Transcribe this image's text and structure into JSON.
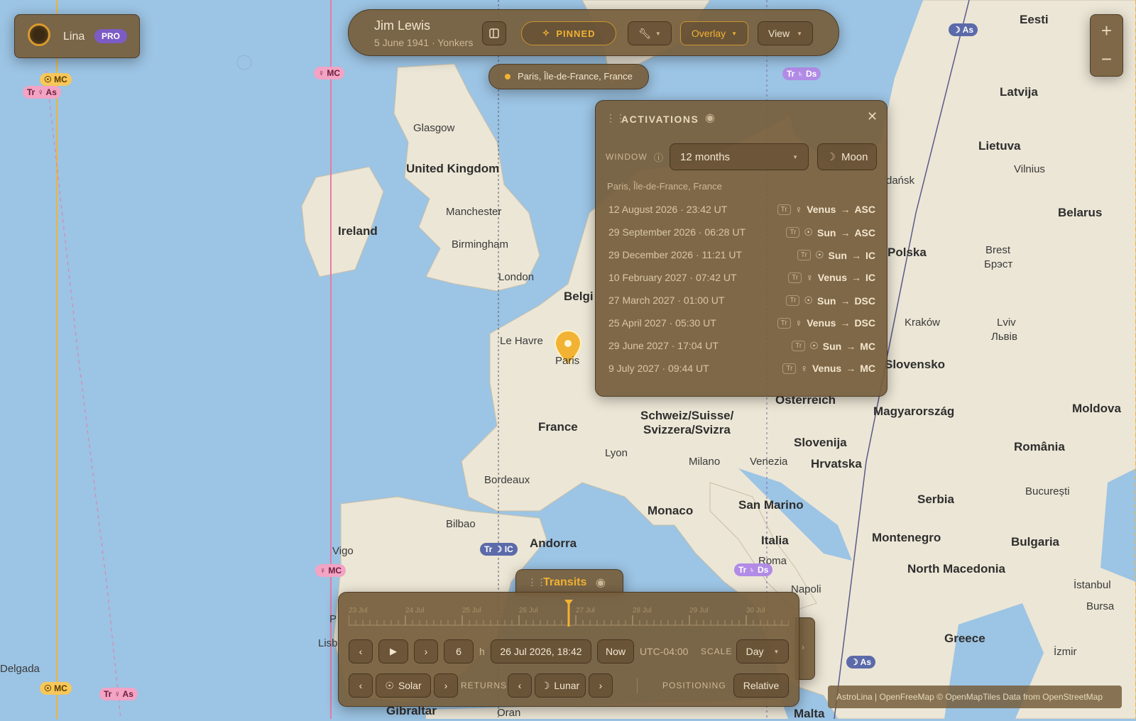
{
  "profile": {
    "name": "Lina",
    "badge": "PRO"
  },
  "chart": {
    "name": "Jim Lewis",
    "subtitle": "5 June 1941 · Yonkers"
  },
  "toolbar": {
    "pinned_label": "PINNED",
    "overlay_label": "Overlay",
    "view_label": "View"
  },
  "location_chip": {
    "label": "Paris, Île-de-France, France"
  },
  "zoom": {
    "plus": "+",
    "minus": "−"
  },
  "activations": {
    "title": "ACTIVATIONS",
    "window_label": "WINDOW",
    "window_value": "12 months",
    "moon_label": "Moon",
    "place": "Paris, Île-de-France, France",
    "rows": [
      {
        "date": "12 August 2026 · 23:42 UT",
        "tag": "Tr",
        "glyph": "♀",
        "planet": "Venus",
        "arrow": "→",
        "angle": "ASC"
      },
      {
        "date": "29 September 2026 · 06:28 UT",
        "tag": "Tr",
        "glyph": "☉",
        "planet": "Sun",
        "arrow": "→",
        "angle": "ASC"
      },
      {
        "date": "29 December 2026 · 11:21 UT",
        "tag": "Tr",
        "glyph": "☉",
        "planet": "Sun",
        "arrow": "→",
        "angle": "IC"
      },
      {
        "date": "10 February 2027 · 07:42 UT",
        "tag": "Tr",
        "glyph": "♀",
        "planet": "Venus",
        "arrow": "→",
        "angle": "IC"
      },
      {
        "date": "27 March 2027 · 01:00 UT",
        "tag": "Tr",
        "glyph": "☉",
        "planet": "Sun",
        "arrow": "→",
        "angle": "DSC"
      },
      {
        "date": "25 April 2027 · 05:30 UT",
        "tag": "Tr",
        "glyph": "♀",
        "planet": "Venus",
        "arrow": "→",
        "angle": "DSC"
      },
      {
        "date": "29 June 2027 · 17:04 UT",
        "tag": "Tr",
        "glyph": "☉",
        "planet": "Sun",
        "arrow": "→",
        "angle": "MC"
      },
      {
        "date": "9 July 2027 · 09:44 UT",
        "tag": "Tr",
        "glyph": "♀",
        "planet": "Venus",
        "arrow": "→",
        "angle": "MC"
      }
    ]
  },
  "transits": {
    "tab_label": "Transits",
    "ticks": [
      "23 Jul",
      "24 Jul",
      "25 Jul",
      "26 Jul",
      "27 Jul",
      "28 Jul",
      "29 Jul",
      "30 Jul"
    ],
    "step_value": "6",
    "step_unit": "h",
    "datetime": "26 Jul 2026, 18:42",
    "now_label": "Now",
    "timezone": "UTC-04:00",
    "scale_label": "SCALE",
    "scale_value": "Day",
    "solar_label": "Solar",
    "returns_label": "RETURNS",
    "lunar_label": "Lunar",
    "positioning_label": "POSITIONING",
    "positioning_value": "Relative"
  },
  "attribution": "AstroLina | OpenFreeMap © OpenMapTiles Data from OpenStreetMap",
  "line_tags": [
    {
      "text": "☉ MC",
      "style": "yellow"
    },
    {
      "text": "Tr ♀ As",
      "style": "pink"
    },
    {
      "text": "♀ MC",
      "style": "pink"
    },
    {
      "text": "Tr ♄ Ds",
      "style": "purple"
    },
    {
      "text": "☽ As",
      "style": "blue"
    },
    {
      "text": "Tr ☽ IC",
      "style": "blue"
    },
    {
      "text": "♀ MC",
      "style": "pink"
    },
    {
      "text": "Tr ♄ Ds",
      "style": "purple"
    },
    {
      "text": "☽ As",
      "style": "blue"
    },
    {
      "text": "☉ MC",
      "style": "yellow"
    },
    {
      "text": "Tr ♀ As",
      "style": "pink"
    }
  ],
  "map_labels": {
    "countries": [
      "United Kingdom",
      "Ireland",
      "France",
      "Belgi",
      "Polska",
      "Latvija",
      "Lietuva",
      "Eesti",
      "Belarus",
      "Slovensko",
      "Magyarország",
      "Moldova",
      "România",
      "Slovenija",
      "Hrvatska",
      "Serbia",
      "Montenegro",
      "Bulgaria",
      "North Macedonia",
      "Greece",
      "Italia",
      "Andorra",
      "Monaco",
      "San Marino",
      "Österreich",
      "Schweiz/Suisse/",
      "Svizzera/Svizra",
      "Malta",
      "Gibraltar"
    ],
    "cities": [
      "Glasgow",
      "Manchester",
      "Birmingham",
      "London",
      "Le Havre",
      "Paris",
      "Bordeaux",
      "Bilbao",
      "Vigo",
      "Lyon",
      "Milano",
      "Venezia",
      "Roma",
      "Napoli",
      "Kraków",
      "Lviv",
      "Львів",
      "Brest",
      "Брэст",
      "Vilnius",
      "dańsk",
      "București",
      "İstanbul",
      "Bursa",
      "İzmir",
      "Oran",
      "Delgada",
      "Lisb",
      "P"
    ]
  }
}
